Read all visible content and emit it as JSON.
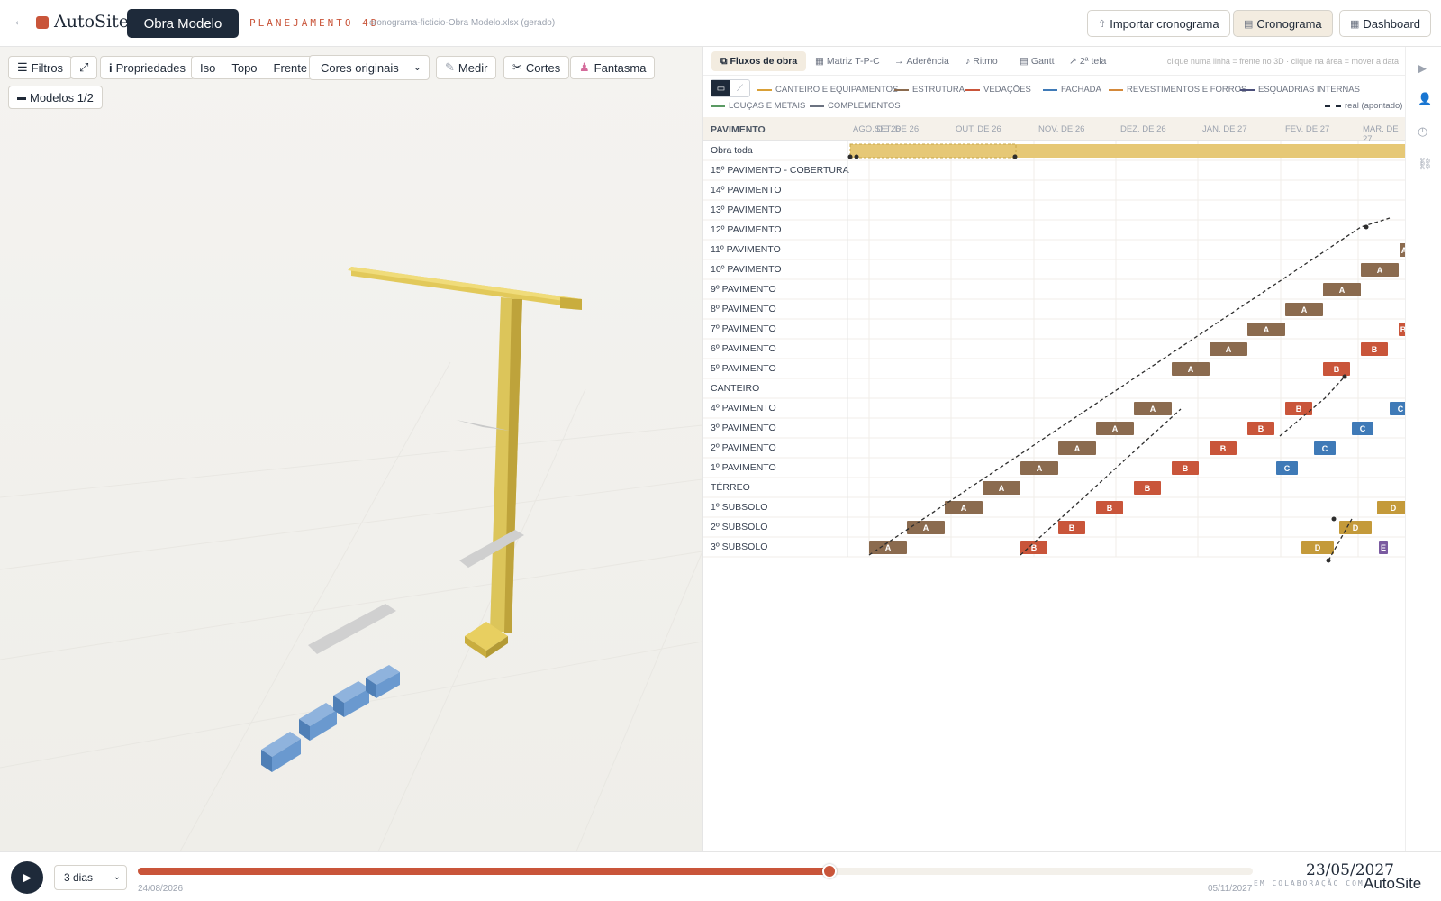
{
  "topbar": {
    "back_icon": "arrow-left-icon",
    "app_name": "AutoSite",
    "project": "Obra Modelo",
    "mode": "PLANEJAMENTO 4D",
    "file": "cronograma-ficticio-Obra Modelo.xlsx (gerado)",
    "import_label": "Importar cronograma",
    "schedule_label": "Cronograma",
    "dashboard_label": "Dashboard"
  },
  "viewer_toolbar": {
    "filters": "Filtros",
    "expand": "⤢",
    "properties": "Propriedades",
    "iso": "Iso",
    "top": "Topo",
    "front": "Frente",
    "colors": "Cores originais",
    "measure": "Medir",
    "cuts": "Cortes",
    "ghost": "Fantasma",
    "models": "Modelos 1/2"
  },
  "panel": {
    "tabs": [
      "Fluxos de obra",
      "Matriz T-P-C",
      "Aderência",
      "Ritmo",
      "Gantt",
      "2ª tela"
    ],
    "hint": "clique numa linha = frente no 3D · clique na área = mover a data",
    "legend": [
      {
        "label": "CANTEIRO E EQUIPAMENTOS",
        "color": "#d9a037"
      },
      {
        "label": "ESTRUTURA",
        "color": "#8b6b4f"
      },
      {
        "label": "VEDAÇÕES",
        "color": "#c9553a"
      },
      {
        "label": "FACHADA",
        "color": "#3f7ab7"
      },
      {
        "label": "REVESTIMENTOS E FORROS",
        "color": "#d4893a"
      },
      {
        "label": "ESQUADRIAS INTERNAS",
        "color": "#4b4f7a"
      },
      {
        "label": "LOUÇAS E METAIS",
        "color": "#5a9a63"
      },
      {
        "label": "COMPLEMENTOS",
        "color": "#6b7280"
      }
    ],
    "legend_real": "real (apontado)",
    "column_header": "PAVIMENTO",
    "months": [
      "AGO. DE 26",
      "SET. DE 26",
      "OUT. DE 26",
      "NOV. DE 26",
      "DEZ. DE 26",
      "JAN. DE 27",
      "FEV. DE 27",
      "MAR. DE 27"
    ],
    "rows": [
      "Obra toda",
      "15º PAVIMENTO - COBERTURA",
      "14º PAVIMENTO",
      "13º PAVIMENTO",
      "12º PAVIMENTO",
      "11º PAVIMENTO",
      "10º PAVIMENTO",
      "9º PAVIMENTO",
      "8º PAVIMENTO",
      "7º PAVIMENTO",
      "6º PAVIMENTO",
      "5º PAVIMENTO",
      "CANTEIRO",
      "4º PAVIMENTO",
      "3º PAVIMENTO",
      "2º PAVIMENTO",
      "1º PAVIMENTO",
      "TÉRREO",
      "1º SUBSOLO",
      "2º SUBSOLO",
      "3º SUBSOLO"
    ]
  },
  "timeline": {
    "speed": "3 dias",
    "start": "24/08/2026",
    "end": "05/11/2027",
    "current": "23/05/2027",
    "progress": 0.62,
    "collab": "EM COLABORAÇÃO COM",
    "collab_brand": "AutoSite"
  }
}
